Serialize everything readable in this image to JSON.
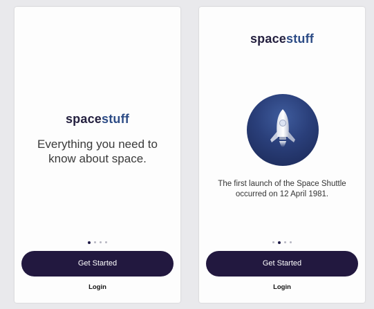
{
  "app": {
    "brand_part1": "space",
    "brand_part2": "stuff"
  },
  "screens": [
    {
      "tagline": "Everything you need to know about space.",
      "cta_label": "Get Started",
      "login_label": "Login",
      "pagination": {
        "total": 4,
        "active": 1
      }
    },
    {
      "illustration": "rocket-icon",
      "fact": "The first launch of the Space Shuttle occurred on 12 April 1981.",
      "cta_label": "Get Started",
      "login_label": "Login",
      "pagination": {
        "total": 4,
        "active": 2
      }
    }
  ],
  "colors": {
    "primary": "#22183f",
    "brand_dark": "#24203f",
    "brand_blue": "#2d4c86",
    "illustration_bg": "#2a3f7a"
  }
}
